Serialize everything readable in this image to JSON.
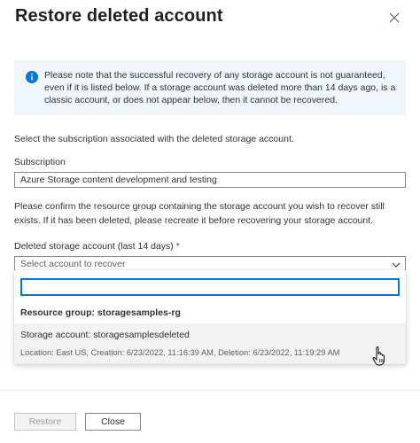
{
  "header": {
    "title": "Restore deleted account",
    "close_icon": "close-icon"
  },
  "info": {
    "icon": "info-icon",
    "icon_color": "#0078d4",
    "background": "#eff6fc",
    "text": "Please note that the successful recovery of any storage account is not guaranteed, even if it is listed below. If a storage account was deleted more than 14 days ago, is a classic account, or does not appear below, then it cannot be recovered."
  },
  "subscription_section": {
    "instruction": "Select the subscription associated with the deleted storage account.",
    "label": "Subscription",
    "selected_value": "Azure Storage content development and testing"
  },
  "resource_group_note": "Please confirm the resource group containing the storage account you wish to recover still exists. If it has been deleted, please recreate it before recovering your storage account.",
  "account_select": {
    "label": "Deleted storage account (last 14 days)",
    "required_mark": "*",
    "placeholder": "Select account to recover",
    "dropdown": {
      "search_value": "",
      "group_header": "Resource group: storagesamples-rg",
      "options": [
        {
          "title": "Storage account: storagesamplesdeleted",
          "detail": "Location: East US, Creation: 6/23/2022, 11:16:39 AM, Deletion: 6/23/2022, 11:19:29 AM"
        }
      ]
    }
  },
  "footer": {
    "restore_label": "Restore",
    "close_label": "Close"
  },
  "colors": {
    "accent": "#0078d4",
    "required": "#a4262c",
    "hover_row": "#f3f2f1"
  }
}
